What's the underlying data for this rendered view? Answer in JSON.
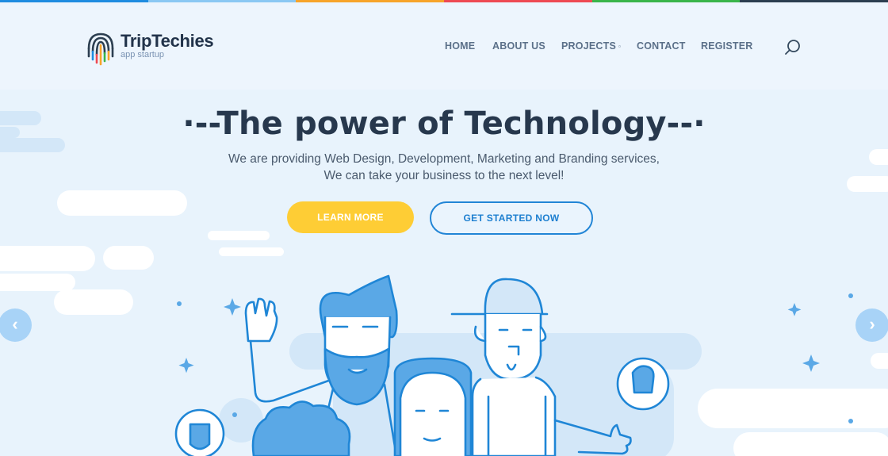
{
  "colors": {
    "strip": [
      "#1f8ce0",
      "#8bc8f3",
      "#f7a42a",
      "#ee4a53",
      "#39b54a",
      "#2c3e50"
    ],
    "background": "#e8f3fc",
    "accent_blue": "#2185d6",
    "accent_yellow": "#fecd35",
    "text_dark": "#27384d"
  },
  "brand": {
    "name": "TripTechies",
    "tagline": "app startup",
    "icon": "fingerprint-logo-icon"
  },
  "nav": {
    "items": [
      {
        "label": "HOME"
      },
      {
        "label": "ABOUT US"
      },
      {
        "label": "PROJECTS",
        "caret": "▫"
      },
      {
        "label": "CONTACT"
      },
      {
        "label": "REGISTER"
      }
    ],
    "search_icon": "search-icon"
  },
  "hero": {
    "headline_prefix": "·--",
    "headline": "The power of Technology",
    "headline_suffix": "--·",
    "description_line1": "We are providing Web Design, Development, Marketing and Branding services,",
    "description_line2": "We can take your business to the next level!",
    "primary_button": "LEARN MORE",
    "secondary_button": "GET STARTED NOW",
    "prev_arrow": "‹",
    "next_arrow": "›"
  }
}
